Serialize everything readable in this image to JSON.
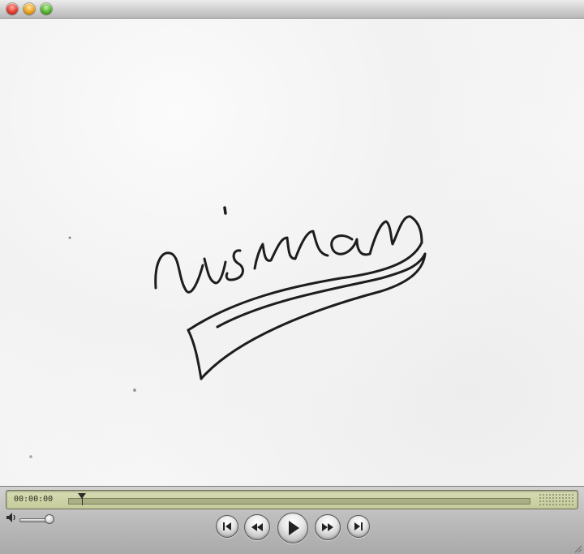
{
  "window": {
    "controls": [
      "close-button",
      "minimize-button",
      "zoom-button"
    ]
  },
  "video": {
    "handwriting": "visman"
  },
  "controller": {
    "timecode": "00:00:00",
    "playback_position": 0.03,
    "volume_level": 0.85,
    "buttons": [
      "go-to-start",
      "rewind",
      "play",
      "fast-forward",
      "go-to-end"
    ]
  }
}
